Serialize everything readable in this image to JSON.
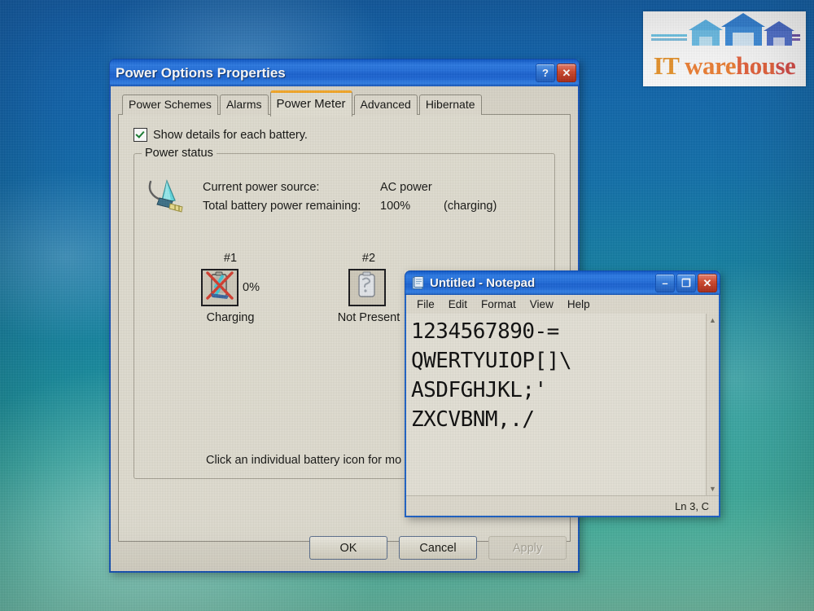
{
  "logo": {
    "name": "IT warehouse",
    "text_parts": [
      "IT",
      " ware",
      "hou",
      "se"
    ],
    "colors": {
      "building_left": "#5ab4e8",
      "building_center": "#2f7fd4",
      "building_right": "#4668c8",
      "rule_left": "#6fc7e8",
      "rule_right": "#6b4fa8",
      "text_start": "#e8932a",
      "text_end": "#d94a44"
    }
  },
  "power_dialog": {
    "title": "Power Options Properties",
    "help_button": "?",
    "close_button": "✕",
    "tabs": [
      {
        "label": "Power Schemes",
        "active": false
      },
      {
        "label": "Alarms",
        "active": false
      },
      {
        "label": "Power Meter",
        "active": true
      },
      {
        "label": "Advanced",
        "active": false
      },
      {
        "label": "Hibernate",
        "active": false
      }
    ],
    "show_details_checkbox": {
      "label": "Show details for each battery.",
      "checked": true
    },
    "power_status": {
      "group_label": "Power status",
      "rows": [
        {
          "key": "Current power source:",
          "value": "AC power",
          "extra": ""
        },
        {
          "key": "Total battery power remaining:",
          "value": "100%",
          "extra": "(charging)"
        }
      ],
      "batteries": [
        {
          "number": "#1",
          "percent": "0%",
          "state": "Charging",
          "present": true
        },
        {
          "number": "#2",
          "percent": "",
          "state": "Not Present",
          "present": false
        }
      ],
      "hint": "Click an individual battery icon for mo"
    },
    "buttons": {
      "ok": "OK",
      "cancel": "Cancel",
      "apply": "Apply",
      "apply_disabled": true
    }
  },
  "notepad": {
    "title": "Untitled - Notepad",
    "minimize_button": "–",
    "maximize_button": "❐",
    "close_button": "✕",
    "menu": [
      "File",
      "Edit",
      "Format",
      "View",
      "Help"
    ],
    "content": "1234567890-=\nQWERTYUIOP[]\\\nASDFGHJKL;'\nZXCVBNM,./",
    "status_bar": "Ln 3, C",
    "scroll_up": "▲",
    "scroll_down": "▼"
  },
  "desktop": {
    "wallpaper_colors": [
      "#0f5ca8",
      "#14849f",
      "#74c0a6"
    ]
  }
}
